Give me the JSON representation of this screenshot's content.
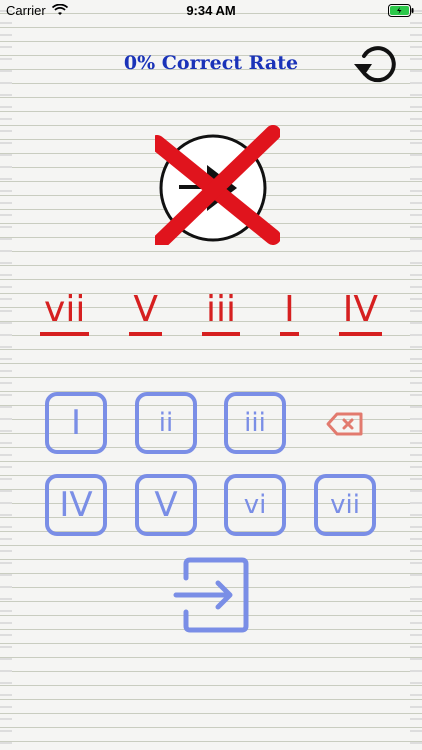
{
  "status": {
    "carrier": "Carrier",
    "time": "9:34 AM"
  },
  "header": {
    "title": "0% Correct Rate"
  },
  "answers": [
    "vii",
    "V",
    "iii",
    "I",
    "IV"
  ],
  "keypad": {
    "row1": [
      "I",
      "ii",
      "iii"
    ],
    "row2": [
      "IV",
      "V",
      "vi",
      "vii"
    ]
  },
  "colors": {
    "accent": "#1a33b8",
    "wrong": "#d62020",
    "key": "#7a8ee6"
  },
  "icons": [
    "wifi-icon",
    "battery-icon",
    "refresh-icon",
    "play-note-icon",
    "wrong-x-icon",
    "backspace-icon",
    "submit-arrow-icon"
  ]
}
